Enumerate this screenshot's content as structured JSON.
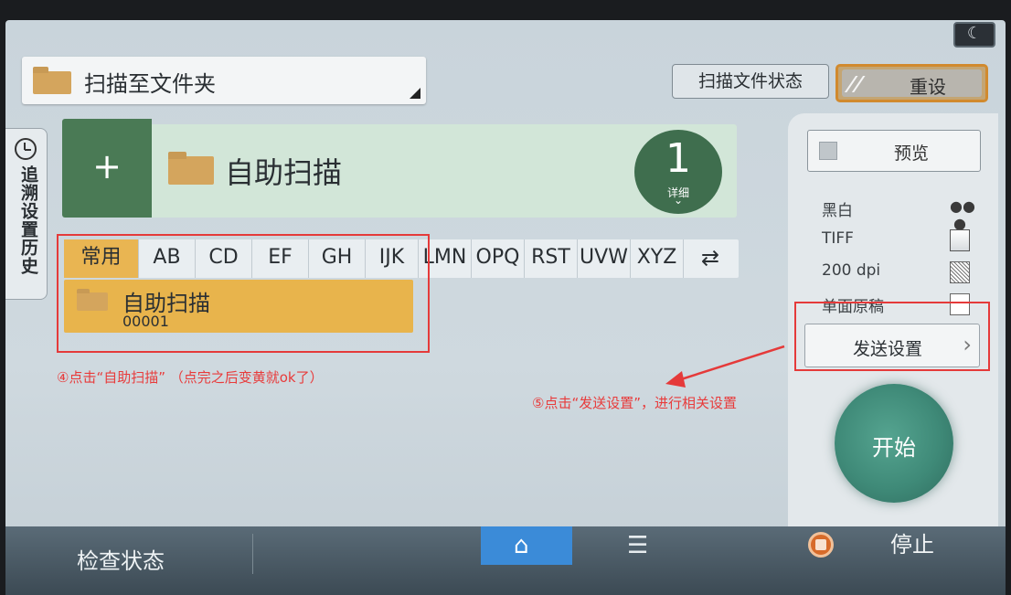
{
  "header": {
    "title": "扫描至文件夹",
    "scan_status_label": "扫描文件状态",
    "reset_label": "重设"
  },
  "history_tab": {
    "label": "追溯设置历史"
  },
  "destination": {
    "add_label": "+",
    "name": "自助扫描",
    "count": "1",
    "count_label": "详细",
    "count_chevron": "⌄"
  },
  "tabs": {
    "items": [
      "常用",
      "AB",
      "CD",
      "EF",
      "GH",
      "IJK",
      "LMN",
      "OPQ",
      "RST",
      "UVW",
      "XYZ"
    ],
    "switch_icon": "⇄"
  },
  "folder_entry": {
    "name": "自助扫描",
    "number": "00001"
  },
  "annotations": {
    "step4": "④点击“自助扫描” （点完之后变黄就ok了）",
    "step5": "⑤点击“发送设置”，进行相关设置"
  },
  "right_panel": {
    "preview_label": "预览",
    "settings": [
      {
        "label": "黑白",
        "icon": "color-dots-icon"
      },
      {
        "label": "TIFF",
        "icon": "image-file-icon"
      },
      {
        "label": "200 dpi",
        "icon": "resolution-icon"
      },
      {
        "label": "单面原稿",
        "icon": "single-side-icon"
      }
    ],
    "send_settings_label": "发送设置",
    "send_chevron": "›",
    "start_label": "开始"
  },
  "bottom_bar": {
    "check_status_label": "检查状态",
    "home_icon": "⌂",
    "menu_icon": "☰",
    "stop_label": "停止"
  },
  "colors": {
    "active_tab": "#e9b552",
    "start_button": "#3f8a78",
    "annotation_red": "#e53a3a",
    "home_button": "#3b8bd8"
  }
}
